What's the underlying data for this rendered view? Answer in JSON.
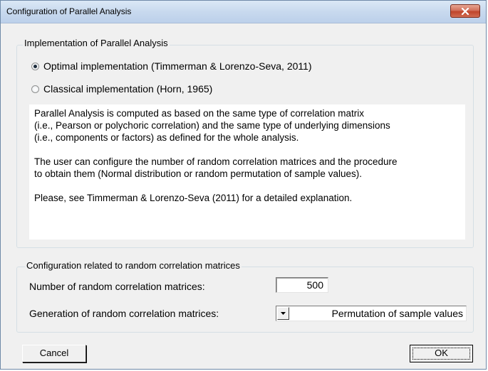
{
  "window": {
    "title": "Configuration of Parallel Analysis"
  },
  "implementation_group": {
    "legend": "Implementation of Parallel Analysis",
    "options": [
      {
        "label": "Optimal implementation (Timmerman & Lorenzo-Seva, 2011)",
        "checked": true
      },
      {
        "label": "Classical implementation (Horn, 1965)",
        "checked": false
      }
    ],
    "description": [
      "Parallel Analysis is computed as based on the same type of correlation matrix",
      "(i.e., Pearson or polychoric correlation) and the same type of underlying dimensions",
      "(i.e., components or factors) as defined for the whole analysis.",
      "The user can configure the number of random correlation matrices and the procedure",
      "to obtain them (Normal distribution or random permutation of sample values).",
      "Please, see Timmerman & Lorenzo-Seva (2011) for a detailed explanation."
    ]
  },
  "random_group": {
    "legend": "Configuration related to random correlation matrices",
    "number_label": "Number of random correlation matrices:",
    "number_value": "500",
    "generation_label": "Generation of random correlation matrices:",
    "generation_value": "Permutation of sample values"
  },
  "buttons": {
    "cancel": "Cancel",
    "ok": "OK"
  }
}
